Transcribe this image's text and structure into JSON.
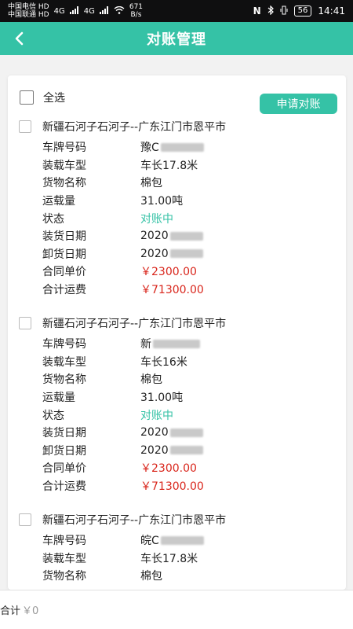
{
  "status_bar": {
    "carrier1": "中国电信",
    "carrier2": "中国联通",
    "hd1": "HD",
    "hd2": "HD",
    "net1": "4G",
    "net2": "4G",
    "speed": "671",
    "speed_unit": "B/s",
    "battery": "56",
    "time": "14:41"
  },
  "header": {
    "title": "对账管理"
  },
  "toolbar": {
    "select_all_label": "全选",
    "apply_button_label": "申请对账"
  },
  "labels": {
    "plate": "车牌号码",
    "vehicle_type": "装载车型",
    "cargo": "货物名称",
    "quantity": "运载量",
    "status": "状态",
    "load_date": "装货日期",
    "unload_date": "卸货日期",
    "unit_price": "合同单价",
    "total_freight": "合计运费"
  },
  "orders": [
    {
      "route": "新疆石河子石河子--广东江门市恩平市",
      "plate": "豫C",
      "vehicle_type": "车长17.8米",
      "cargo": "棉包",
      "quantity": "31.00吨",
      "status": "对账中",
      "load_date": "2020",
      "unload_date": "2020",
      "unit_price": "￥2300.00",
      "total_freight": "￥71300.00"
    },
    {
      "route": "新疆石河子石河子--广东江门市恩平市",
      "plate": "新",
      "vehicle_type": "车长16米",
      "cargo": "棉包",
      "quantity": "31.00吨",
      "status": "对账中",
      "load_date": "2020",
      "unload_date": "2020",
      "unit_price": "￥2300.00",
      "total_freight": "￥71300.00"
    },
    {
      "route": "新疆石河子石河子--广东江门市恩平市",
      "plate": "皖C",
      "vehicle_type": "车长17.8米",
      "cargo": "棉包"
    }
  ],
  "footer": {
    "total_label": "合计",
    "total_value": "￥0"
  },
  "colors": {
    "accent": "#35c2a6",
    "money": "#d9261c"
  }
}
